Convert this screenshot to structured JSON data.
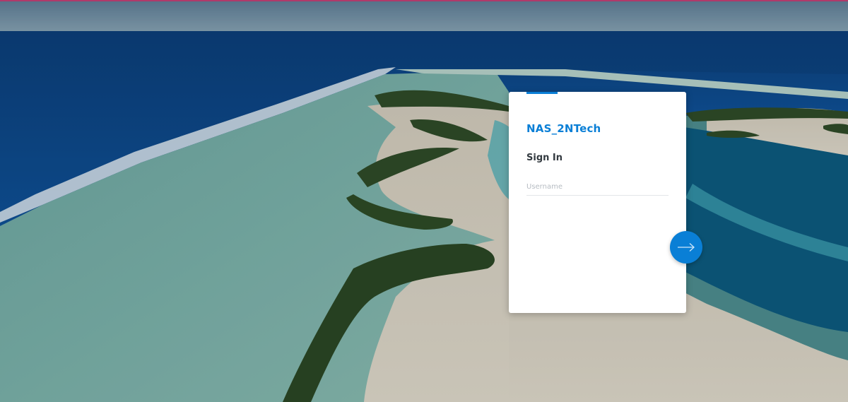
{
  "app": {
    "brand": "NAS_2NTech",
    "heading": "Sign In"
  },
  "form": {
    "username_placeholder": "Username",
    "username_value": ""
  },
  "submit": {
    "icon": "arrow-right-icon"
  },
  "colors": {
    "accent": "#0a7fd6",
    "heading": "#333a40",
    "card": "#ffffff"
  }
}
